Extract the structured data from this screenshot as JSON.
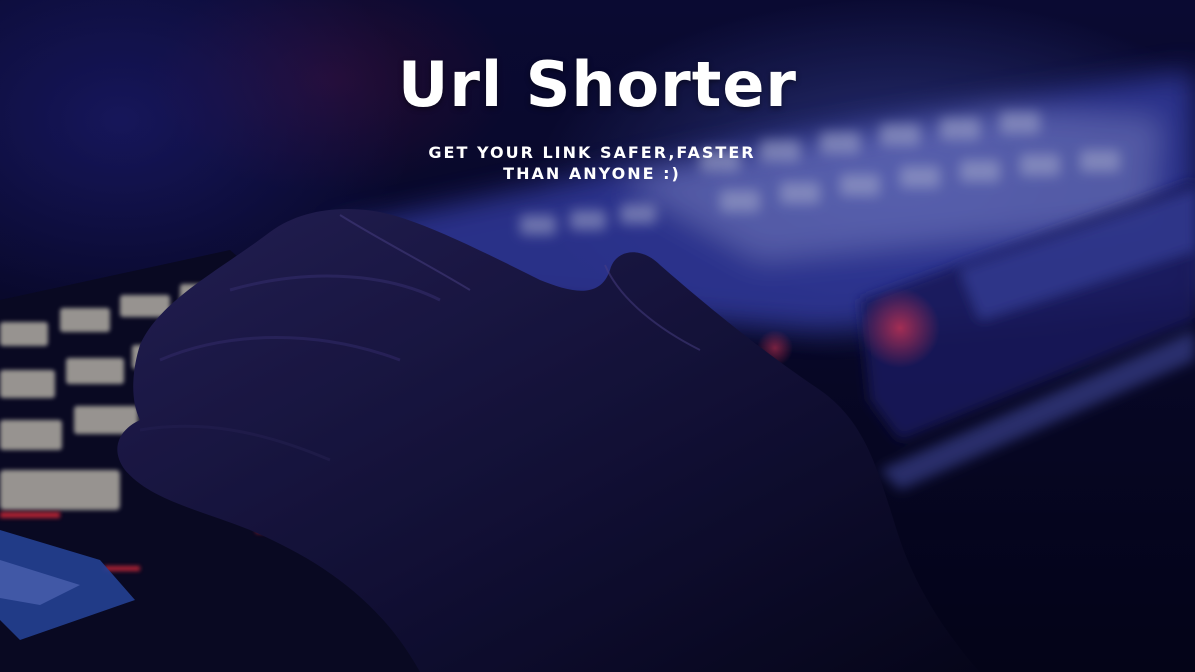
{
  "hero": {
    "title": "Url Shorter",
    "tagline": "GET YOUR LINK SAFER,FASTER THAN ANYONE :)"
  },
  "colors": {
    "background_dark": "#0a0a2e",
    "glow_blue": "#5a6ee6",
    "accent_red": "#ff2d4a",
    "text": "#ffffff"
  }
}
